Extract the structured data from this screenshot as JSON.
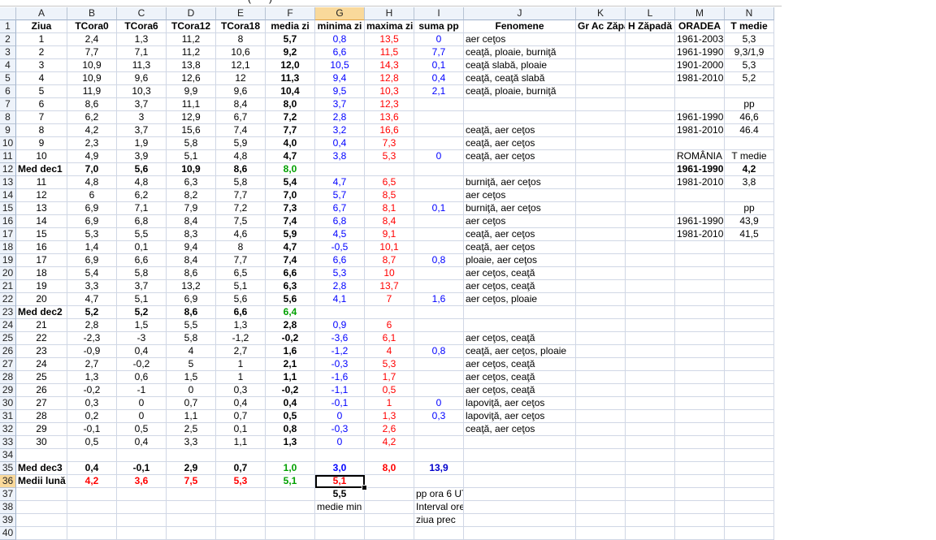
{
  "top_fragment": "(· · · )",
  "columns": [
    "A",
    "B",
    "C",
    "D",
    "E",
    "F",
    "G",
    "H",
    "I",
    "J",
    "K",
    "L",
    "M",
    "N"
  ],
  "selected_column": "G",
  "selected_row": "36",
  "rows": [
    {
      "n": "1",
      "cells": {
        "A": "Ziua",
        "B": "TCora0",
        "C": "TCora6",
        "D": "TCora12",
        "E": "TCora18",
        "F": "media zi",
        "G": "minima zi",
        "H": "maxima zi",
        "I": "suma pp",
        "J": "Fenomene",
        "K": "Gr Ac Zăpadă",
        "L": "H Zăpadă",
        "M": "ORADEA",
        "N": "T medie"
      }
    },
    {
      "n": "2",
      "cells": {
        "A": "1",
        "B": "2,4",
        "C": "1,3",
        "D": "11,2",
        "E": "8",
        "F": "5,7",
        "G": "0,8",
        "H": "13,5",
        "I": "0",
        "J": "aer ceţos",
        "M": "1961-2003",
        "N": "5,3"
      }
    },
    {
      "n": "3",
      "cells": {
        "A": "2",
        "B": "7,7",
        "C": "7,1",
        "D": "11,2",
        "E": "10,6",
        "F": "9,2",
        "G": "6,6",
        "H": "11,5",
        "I": "7,7",
        "J": "ceaţă, ploaie, burniţă",
        "M": "1961-1990",
        "N": "9,3/1,9"
      }
    },
    {
      "n": "4",
      "cells": {
        "A": "3",
        "B": "10,9",
        "C": "11,3",
        "D": "13,8",
        "E": "12,1",
        "F": "12,0",
        "G": "10,5",
        "H": "14,3",
        "I": "0,1",
        "J": "ceaţă slabă, ploaie",
        "M": "1901-2000",
        "N": "5,3"
      }
    },
    {
      "n": "5",
      "cells": {
        "A": "4",
        "B": "10,9",
        "C": "9,6",
        "D": "12,6",
        "E": "12",
        "F": "11,3",
        "G": "9,4",
        "H": "12,8",
        "I": "0,4",
        "J": "ceaţă, ceaţă slabă",
        "M": "1981-2010",
        "N": "5,2"
      }
    },
    {
      "n": "6",
      "cells": {
        "A": "5",
        "B": "11,9",
        "C": "10,3",
        "D": "9,9",
        "E": "9,6",
        "F": "10,4",
        "G": "9,5",
        "H": "10,3",
        "I": "2,1",
        "J": "ceaţă, ploaie, burniţă"
      }
    },
    {
      "n": "7",
      "cells": {
        "A": "6",
        "B": "8,6",
        "C": "3,7",
        "D": "11,1",
        "E": "8,4",
        "F": "8,0",
        "G": "3,7",
        "H": "12,3",
        "N": "pp"
      }
    },
    {
      "n": "8",
      "cells": {
        "A": "7",
        "B": "6,2",
        "C": "3",
        "D": "12,9",
        "E": "6,7",
        "F": "7,2",
        "G": "2,8",
        "H": "13,6",
        "M": "1961-1990",
        "N": "46,6"
      }
    },
    {
      "n": "9",
      "cells": {
        "A": "8",
        "B": "4,2",
        "C": "3,7",
        "D": "15,6",
        "E": "7,4",
        "F": "7,7",
        "G": "3,2",
        "H": "16,6",
        "J": "ceaţă, aer ceţos",
        "M": "1981-2010",
        "N": "46.4"
      }
    },
    {
      "n": "10",
      "cells": {
        "A": "9",
        "B": "2,3",
        "C": "1,9",
        "D": "5,8",
        "E": "5,9",
        "F": "4,0",
        "G": "0,4",
        "H": "7,3",
        "J": "ceaţă, aer ceţos"
      }
    },
    {
      "n": "11",
      "cells": {
        "A": "10",
        "B": "4,9",
        "C": "3,9",
        "D": "5,1",
        "E": "4,8",
        "F": "4,7",
        "G": "3,8",
        "H": "5,3",
        "I": "0",
        "J": "ceaţă, aer ceţos",
        "M": "ROMÂNIA",
        "N": "T medie"
      }
    },
    {
      "n": "12",
      "cells": {
        "A": "Med dec1",
        "B": "7,0",
        "C": "5,6",
        "D": "10,9",
        "E": "8,6",
        "F": "8,0",
        "M": "1961-1990",
        "N": "4,2"
      }
    },
    {
      "n": "13",
      "cells": {
        "A": "11",
        "B": "4,8",
        "C": "4,8",
        "D": "6,3",
        "E": "5,8",
        "F": "5,4",
        "G": "4,7",
        "H": "6,5",
        "J": "burniţă, aer ceţos",
        "M": "1981-2010",
        "N": "3,8"
      }
    },
    {
      "n": "14",
      "cells": {
        "A": "12",
        "B": "6",
        "C": "6,2",
        "D": "8,2",
        "E": "7,7",
        "F": "7,0",
        "G": "5,7",
        "H": "8,5",
        "J": "aer ceţos"
      }
    },
    {
      "n": "15",
      "cells": {
        "A": "13",
        "B": "6,9",
        "C": "7,1",
        "D": "7,9",
        "E": "7,2",
        "F": "7,3",
        "G": "6,7",
        "H": "8,1",
        "I": "0,1",
        "J": "burniţă, aer ceţos",
        "N": "pp"
      }
    },
    {
      "n": "16",
      "cells": {
        "A": "14",
        "B": "6,9",
        "C": "6,8",
        "D": "8,4",
        "E": "7,5",
        "F": "7,4",
        "G": "6,8",
        "H": "8,4",
        "J": "aer ceţos",
        "M": "1961-1990",
        "N": "43,9"
      }
    },
    {
      "n": "17",
      "cells": {
        "A": "15",
        "B": "5,3",
        "C": "5,5",
        "D": "8,3",
        "E": "4,6",
        "F": "5,9",
        "G": "4,5",
        "H": "9,1",
        "J": "ceaţă, aer ceţos",
        "M": "1981-2010",
        "N": "41,5"
      }
    },
    {
      "n": "18",
      "cells": {
        "A": "16",
        "B": "1,4",
        "C": "0,1",
        "D": "9,4",
        "E": "8",
        "F": "4,7",
        "G": "-0,5",
        "H": "10,1",
        "J": "ceaţă, aer ceţos"
      }
    },
    {
      "n": "19",
      "cells": {
        "A": "17",
        "B": "6,9",
        "C": "6,6",
        "D": "8,4",
        "E": "7,7",
        "F": "7,4",
        "G": "6,6",
        "H": "8,7",
        "I": "0,8",
        "J": "ploaie, aer ceţos"
      }
    },
    {
      "n": "20",
      "cells": {
        "A": "18",
        "B": "5,4",
        "C": "5,8",
        "D": "8,6",
        "E": "6,5",
        "F": "6,6",
        "G": "5,3",
        "H": "10",
        "J": "aer ceţos, ceaţă"
      }
    },
    {
      "n": "21",
      "cells": {
        "A": "19",
        "B": "3,3",
        "C": "3,7",
        "D": "13,2",
        "E": "5,1",
        "F": "6,3",
        "G": "2,8",
        "H": "13,7",
        "J": "aer ceţos, ceaţă"
      }
    },
    {
      "n": "22",
      "cells": {
        "A": "20",
        "B": "4,7",
        "C": "5,1",
        "D": "6,9",
        "E": "5,6",
        "F": "5,6",
        "G": "4,1",
        "H": "7",
        "I": "1,6",
        "J": "aer ceţos, ploaie"
      }
    },
    {
      "n": "23",
      "cells": {
        "A": "Med dec2",
        "B": "5,2",
        "C": "5,2",
        "D": "8,6",
        "E": "6,6",
        "F": "6,4"
      }
    },
    {
      "n": "24",
      "cells": {
        "A": "21",
        "B": "2,8",
        "C": "1,5",
        "D": "5,5",
        "E": "1,3",
        "F": "2,8",
        "G": "0,9",
        "H": "6"
      }
    },
    {
      "n": "25",
      "cells": {
        "A": "22",
        "B": "-2,3",
        "C": "-3",
        "D": "5,8",
        "E": "-1,2",
        "F": "-0,2",
        "G": "-3,6",
        "H": "6,1",
        "J": "aer ceţos, ceaţă"
      }
    },
    {
      "n": "26",
      "cells": {
        "A": "23",
        "B": "-0,9",
        "C": "0,4",
        "D": "4",
        "E": "2,7",
        "F": "1,6",
        "G": "-1,2",
        "H": "4",
        "I": "0,8",
        "J": "ceaţă, aer ceţos, ploaie"
      }
    },
    {
      "n": "27",
      "cells": {
        "A": "24",
        "B": "2,7",
        "C": "-0,2",
        "D": "5",
        "E": "1",
        "F": "2,1",
        "G": "-0,3",
        "H": "5,3",
        "J": "aer ceţos, ceaţă"
      }
    },
    {
      "n": "28",
      "cells": {
        "A": "25",
        "B": "1,3",
        "C": "0,6",
        "D": "1,5",
        "E": "1",
        "F": "1,1",
        "G": "-1,6",
        "H": "1,7",
        "J": "aer  ceţos, ceaţă"
      }
    },
    {
      "n": "29",
      "cells": {
        "A": "26",
        "B": "-0,2",
        "C": "-1",
        "D": "0",
        "E": "0,3",
        "F": "-0,2",
        "G": "-1,1",
        "H": "0,5",
        "J": "aer ceţos, ceaţă"
      }
    },
    {
      "n": "30",
      "cells": {
        "A": "27",
        "B": "0,3",
        "C": "0",
        "D": "0,7",
        "E": "0,4",
        "F": "0,4",
        "G": "-0,1",
        "H": "1",
        "I": "0",
        "J": "lapoviţă, aer ceţos"
      }
    },
    {
      "n": "31",
      "cells": {
        "A": "28",
        "B": "0,2",
        "C": "0",
        "D": "1,1",
        "E": "0,7",
        "F": "0,5",
        "G": "0",
        "H": "1,3",
        "I": "0,3",
        "J": "lapoviţă, aer ceţos"
      }
    },
    {
      "n": "32",
      "cells": {
        "A": "29",
        "B": "-0,1",
        "C": "0,5",
        "D": "2,5",
        "E": "0,1",
        "F": "0,8",
        "G": "-0,3",
        "H": "2,6",
        "J": "ceaţă, aer ceţos"
      }
    },
    {
      "n": "33",
      "cells": {
        "A": "30",
        "B": "0,5",
        "C": "0,4",
        "D": "3,3",
        "E": "1,1",
        "F": "1,3",
        "G": "0",
        "H": "4,2"
      }
    },
    {
      "n": "34",
      "cells": {}
    },
    {
      "n": "35",
      "cells": {
        "A": "Med dec3",
        "B": "0,4",
        "C": "-0,1",
        "D": "2,9",
        "E": "0,7",
        "F": "1,0",
        "G": "3,0",
        "H": "8,0",
        "I": "13,9"
      }
    },
    {
      "n": "36",
      "cells": {
        "A": "Medii lună",
        "B": "4,2",
        "C": "3,6",
        "D": "7,5",
        "E": "5,3",
        "F": "5,1",
        "G": "5,1"
      }
    },
    {
      "n": "37",
      "cells": {
        "G": "5,5",
        "I": "pp ora 6 UTC"
      }
    },
    {
      "n": "38",
      "cells": {
        "G": "medie min max",
        "I": "Interval orele 7UTC-6UTC"
      }
    },
    {
      "n": "39",
      "cells": {
        "I": "ziua prec"
      }
    },
    {
      "n": "40",
      "cells": {}
    }
  ],
  "colors": {
    "blue": "#0000ff",
    "red": "#ff0000",
    "green": "#00a000",
    "header_bg": "#eef3fa",
    "selected_header_bg": "#f9d99b"
  }
}
